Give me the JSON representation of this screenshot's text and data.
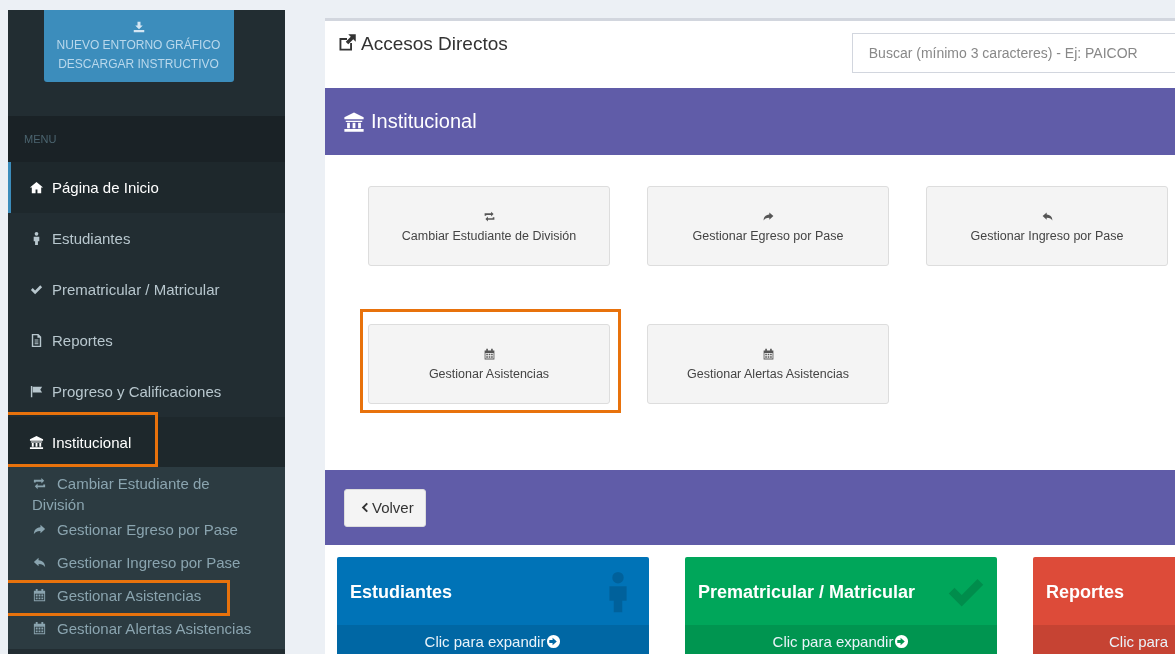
{
  "sidebar": {
    "download_button": {
      "lines": [
        "NUEVO ENTORNO GRÁFICO",
        "DESCARGAR INSTRUCTIVO"
      ]
    },
    "menu_header": "MENU",
    "items": [
      {
        "label": "Página de Inicio",
        "selected": true,
        "expanded": false,
        "highlighted": false
      },
      {
        "label": "Estudiantes",
        "selected": false,
        "expanded": false,
        "highlighted": false
      },
      {
        "label": "Prematricular / Matricular",
        "selected": false,
        "expanded": false,
        "highlighted": false
      },
      {
        "label": "Reportes",
        "selected": false,
        "expanded": false,
        "highlighted": false
      },
      {
        "label": "Progreso y Calificaciones",
        "selected": false,
        "expanded": false,
        "highlighted": false
      },
      {
        "label": "Institucional",
        "selected": false,
        "expanded": true,
        "highlighted": true,
        "children": [
          {
            "label": "Cambiar Estudiante de División",
            "highlighted": false
          },
          {
            "label": "Gestionar Egreso por Pase",
            "highlighted": false
          },
          {
            "label": "Gestionar Ingreso por Pase",
            "highlighted": false
          },
          {
            "label": "Gestionar Asistencias",
            "highlighted": true
          },
          {
            "label": "Gestionar Alertas Asistencias",
            "highlighted": false
          }
        ]
      }
    ]
  },
  "main": {
    "title": "Accesos Directos",
    "search": {
      "placeholder": "Buscar (mínimo 3 caracteres) - Ej: PAICOR"
    },
    "section": {
      "title": "Institucional",
      "tiles": [
        {
          "label": "Cambiar Estudiante de División",
          "highlighted": false
        },
        {
          "label": "Gestionar Egreso por Pase",
          "highlighted": false
        },
        {
          "label": "Gestionar Ingreso por Pase",
          "highlighted": false
        },
        {
          "label": "Gestionar Asistencias",
          "highlighted": true
        },
        {
          "label": "Gestionar Alertas Asistencias",
          "highlighted": false
        }
      ]
    },
    "back_button": "Volver",
    "cards": [
      {
        "title": "Estudiantes",
        "footer": "Clic para expandir",
        "color": "#0073b7"
      },
      {
        "title": "Prematricular / Matricular",
        "footer": "Clic para expandir",
        "color": "#00a65a"
      },
      {
        "title": "Reportes",
        "footer": "Clic para",
        "color": "#dd4b39"
      }
    ]
  }
}
